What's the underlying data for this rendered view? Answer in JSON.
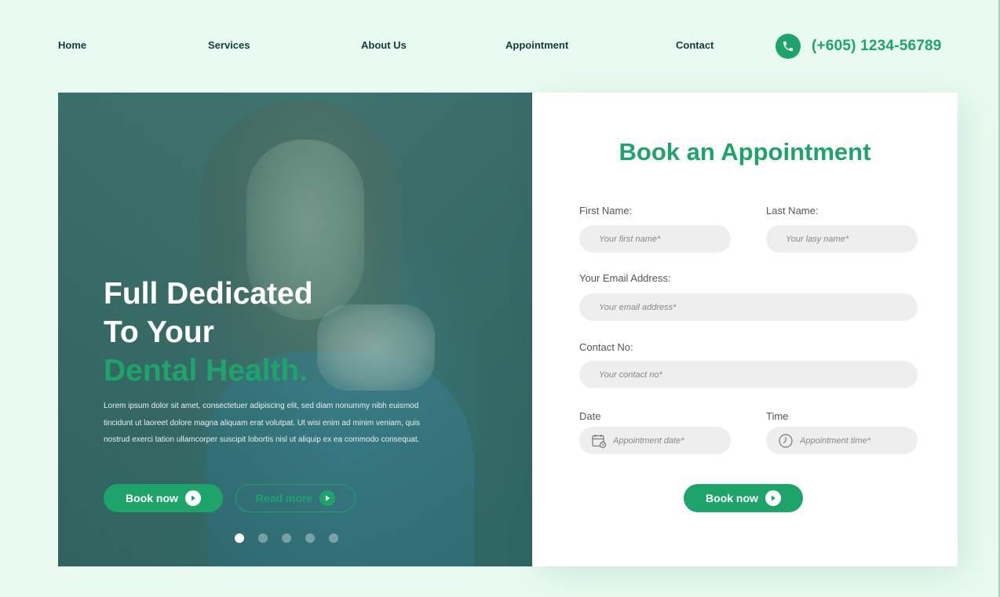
{
  "nav": {
    "items": [
      {
        "label": "Home"
      },
      {
        "label": "Services"
      },
      {
        "label": "About Us"
      },
      {
        "label": "Appointment"
      },
      {
        "label": "Contact"
      }
    ],
    "phone": "(+605) 1234-56789",
    "phone_icon": "phone-icon"
  },
  "hero": {
    "title_line1": "Full Dedicated",
    "title_line2": "To Your",
    "title_line3": "Dental Health.",
    "description": "Lorem ipsum dolor sit amet, consectetuer adipiscing elit, sed diam nonummy nibh euismod tincidunt ut laoreet dolore magna aliquam erat volutpat. Ut wisi enim ad minim veniam, quis nostrud exerci tation ullamcorper suscipit lobortis nisl ut aliquip ex ea commodo consequat.",
    "primary_button": "Book now",
    "secondary_button": "Read more",
    "slides_count": 5,
    "active_slide": 1
  },
  "form": {
    "title": "Book an Appointment",
    "first_name_label": "First Name:",
    "first_name_placeholder": "Your first name*",
    "last_name_label": "Last Name:",
    "last_name_placeholder": "Your lasy name*",
    "email_label": "Your Email Address:",
    "email_placeholder": "Your email address*",
    "contact_label": "Contact No:",
    "contact_placeholder": "Your contact no*",
    "date_label": "Date",
    "date_placeholder": "Appointment date*",
    "time_label": "Time",
    "time_placeholder": "Appointment time*",
    "submit_button": "Book now"
  },
  "colors": {
    "accent": "#1ea46b",
    "background": "#e9fbf1",
    "nav_text": "#123a3a",
    "field_bg": "#eeeeee"
  }
}
